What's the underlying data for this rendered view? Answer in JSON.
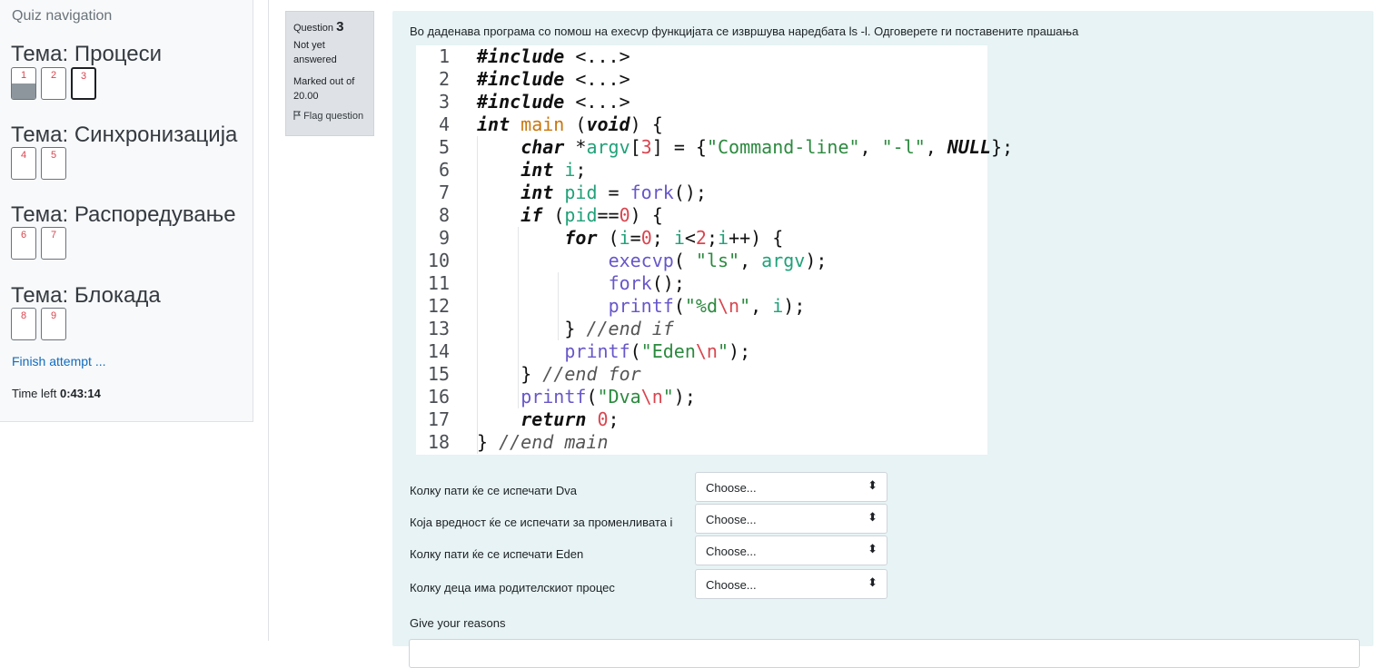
{
  "nav": {
    "title": "Quiz navigation",
    "sections": [
      {
        "title": "Тема: Процеси",
        "buttons": [
          "1",
          "2",
          "3"
        ]
      },
      {
        "title": "Тема: Синхронизација",
        "buttons": [
          "4",
          "5"
        ]
      },
      {
        "title": "Тема: Распоредување",
        "buttons": [
          "6",
          "7"
        ]
      },
      {
        "title": "Тема: Блокада",
        "buttons": [
          "8",
          "9"
        ]
      }
    ],
    "finish": "Finish attempt ...",
    "time_label": "Time left",
    "time_value": "0:43:14"
  },
  "question": {
    "label": "Question",
    "number": "3",
    "state": "Not yet answered",
    "grade": "Marked out of 20.00",
    "flag": "Flag question",
    "text": "Во даденава програма со помош на execvp функцијата се извршува наредбата ls -l. Одговерете ги поставените прашања",
    "code_lines": [
      "#include <...>",
      "#include <...>",
      "#include <...>",
      "int main (void) {",
      "    char *argv[3] = {\"Command-line\", \"-l\", NULL};",
      "    int i;",
      "    int pid = fork();",
      "    if (pid==0) {",
      "        for (i=0; i<2;i++) {",
      "            execvp( \"ls\", argv);",
      "            fork();",
      "            printf(\"%d\\n\", i);",
      "        } //end if",
      "        printf(\"Eden\\n\");",
      "    } //end for",
      "    printf(\"Dva\\n\");",
      "    return 0;",
      "} //end main"
    ],
    "subquestions": [
      {
        "label": "Колку пати ќе се испечати Dva",
        "value": "Choose..."
      },
      {
        "label": "Која вредност ќе се испечати за променливата i",
        "value": "Choose..."
      },
      {
        "label": "Колку пати ќе се испечати Eden",
        "value": "Choose..."
      },
      {
        "label": "Колку деца има родителскиот процес",
        "value": "Choose..."
      }
    ],
    "reasons_label": "Give your reasons"
  },
  "colors": {
    "accent_link": "#0f6cbf",
    "content_bg": "#e7f3f5",
    "info_bg": "#dee2e6"
  },
  "icons": [
    "flag-icon",
    "select-arrow-icon"
  ]
}
